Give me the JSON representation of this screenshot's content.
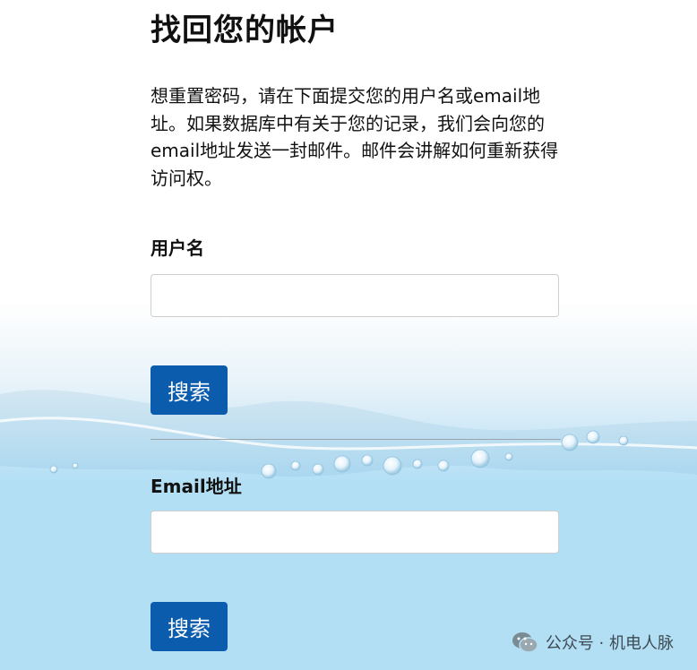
{
  "page": {
    "title": "找回您的帐户",
    "description": "想重置密码，请在下面提交您的用户名或email地址。如果数据库中有关于您的记录，我们会向您的email地址发送一封邮件。邮件会讲解如何重新获得访问权。"
  },
  "username_section": {
    "label": "用户名",
    "input_value": "",
    "search_label": "搜索"
  },
  "email_section": {
    "label": "Email地址",
    "input_value": "",
    "search_label": "搜索"
  },
  "watermark": {
    "text": "公众号 · 机电人脉",
    "icon": "wechat-icon"
  },
  "colors": {
    "button": "#0b5cad",
    "water": "#b3dff5"
  }
}
